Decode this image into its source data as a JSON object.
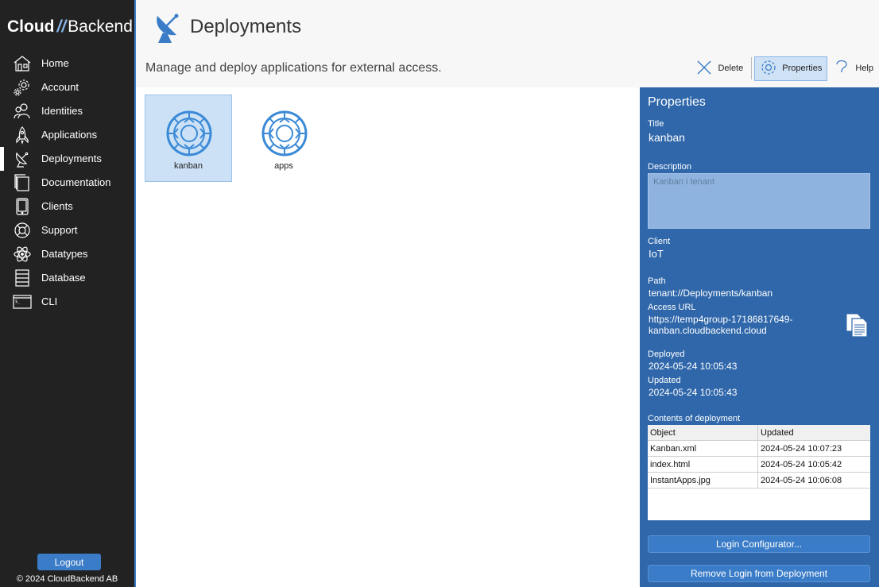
{
  "app": {
    "logo_bold": "Cloud",
    "logo_slash": "//",
    "logo_light": "Backend"
  },
  "sidebar": {
    "items": [
      {
        "label": "Home",
        "icon": "home-icon"
      },
      {
        "label": "Account",
        "icon": "gear-icon"
      },
      {
        "label": "Identities",
        "icon": "users-icon"
      },
      {
        "label": "Applications",
        "icon": "rocket-icon"
      },
      {
        "label": "Deployments",
        "icon": "satellite-dish-icon"
      },
      {
        "label": "Documentation",
        "icon": "documents-icon"
      },
      {
        "label": "Clients",
        "icon": "tablet-icon"
      },
      {
        "label": "Support",
        "icon": "lifebuoy-icon"
      },
      {
        "label": "Datatypes",
        "icon": "atom-icon"
      },
      {
        "label": "Database",
        "icon": "database-icon"
      },
      {
        "label": "CLI",
        "icon": "terminal-icon"
      }
    ],
    "active": "Deployments",
    "logout_label": "Logout",
    "copyright": "© 2024 CloudBackend AB"
  },
  "header": {
    "title": "Deployments",
    "subtitle": "Manage and deploy applications for external access."
  },
  "toolbar": {
    "delete_label": "Delete",
    "properties_label": "Properties",
    "help_label": "Help"
  },
  "deployments": [
    {
      "name": "kanban",
      "selected": true
    },
    {
      "name": "apps",
      "selected": false
    }
  ],
  "properties": {
    "heading": "Properties",
    "title_label": "Title",
    "title_value": "kanban",
    "description_label": "Description",
    "description_value": "Kanban i tenant",
    "client_label": "Client",
    "client_value": "IoT",
    "path_label": "Path",
    "path_value": "tenant://Deployments/kanban",
    "access_url_label": "Access URL",
    "access_url_line1": "https://temp4group-17186817649-",
    "access_url_line2": "kanban.cloudbackend.cloud",
    "deployed_label": "Deployed",
    "deployed_value": "2024-05-24 10:05:43",
    "updated_label": "Updated",
    "updated_value": "2024-05-24 10:05:43",
    "contents_label": "Contents of deployment",
    "table_headers": [
      "Object",
      "Updated"
    ],
    "table_rows": [
      [
        "Kanban.xml",
        "2024-05-24 10:07:23"
      ],
      [
        "index.html",
        "2024-05-24 10:05:42"
      ],
      [
        "InstantApps.jpg",
        "2024-05-24 10:06:08"
      ]
    ],
    "login_configurator_label": "Login Configurator...",
    "remove_login_label": "Remove Login from Deployment"
  },
  "colors": {
    "sidebar_bg": "#222222",
    "accent": "#3a7cc7",
    "panel_bg": "#2f67aa",
    "selected_tile": "#cce1f6"
  }
}
